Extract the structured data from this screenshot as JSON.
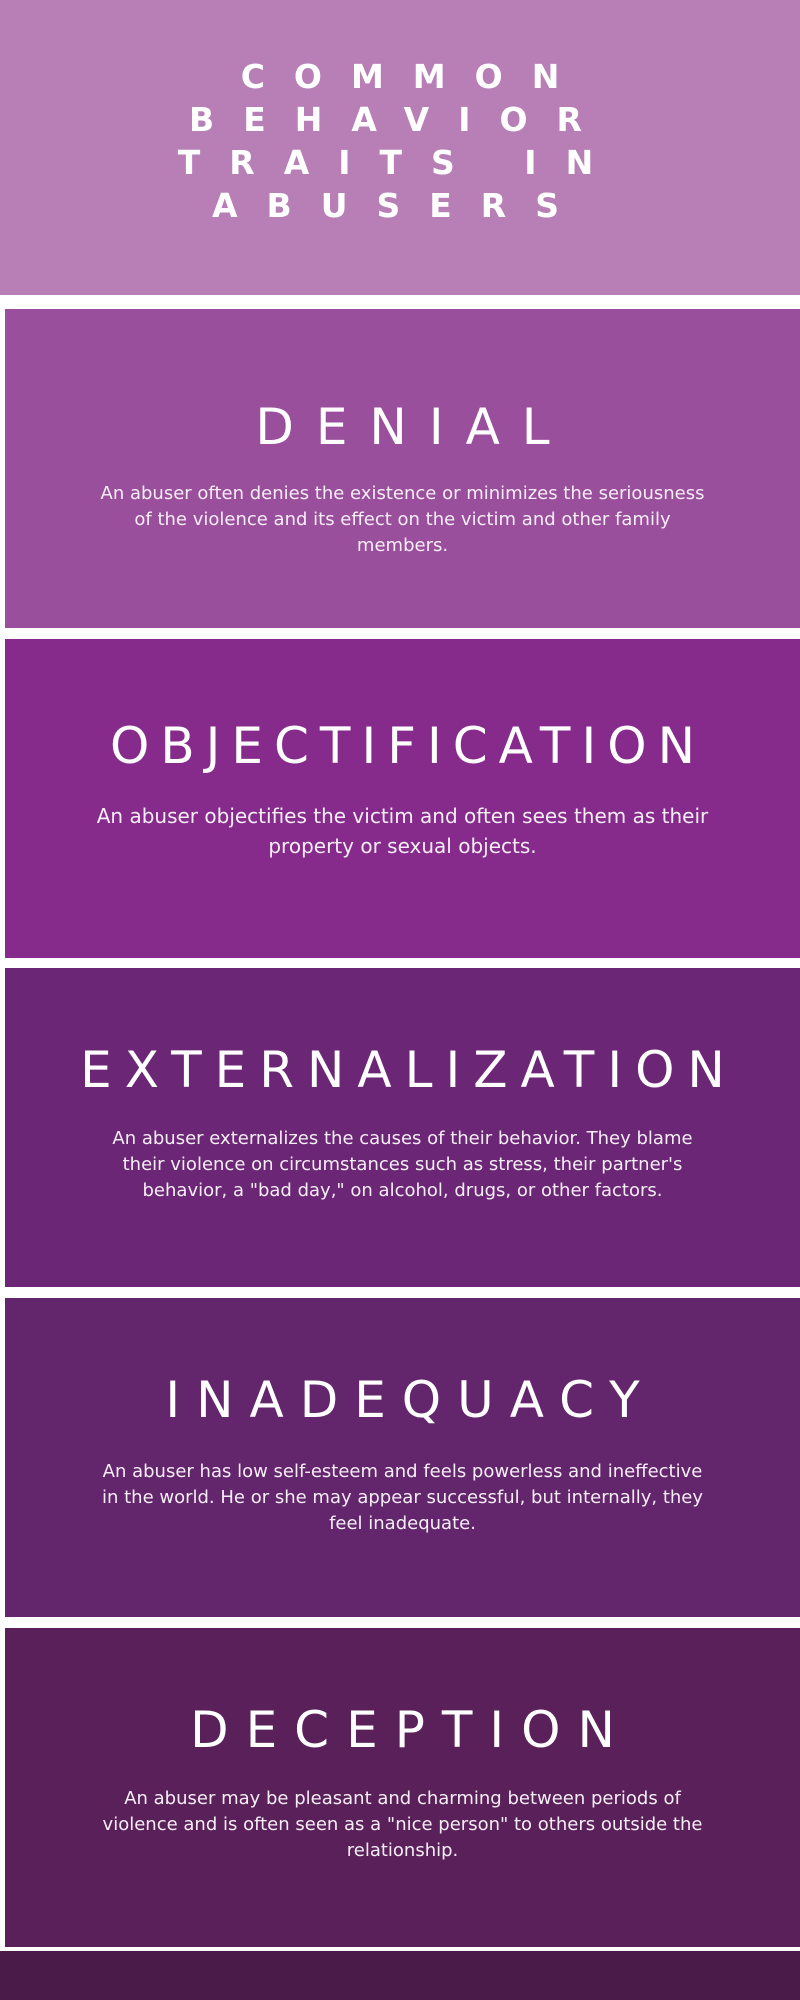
{
  "header": {
    "title": "COMMON\nBEHAVIOR\nTRAITS IN\nABUSERS",
    "color": "#b77fb6"
  },
  "sections": [
    {
      "title": "DENIAL",
      "body": "An abuser often denies the existence or minimizes the seriousness of the violence and its effect on the victim and other family members.",
      "color": "#9a4f9c"
    },
    {
      "title": "OBJECTIFICATION",
      "body": "An abuser objectifies the victim and often sees them as their property or sexual objects.",
      "color": "#862b8c"
    },
    {
      "title": "EXTERNALIZATION",
      "body": "An abuser externalizes the causes of their behavior. They blame their violence on circumstances such as stress, their partner's behavior, a \"bad day,\" on alcohol, drugs, or other factors.",
      "color": "#6b2775"
    },
    {
      "title": "INADEQUACY",
      "body": "An abuser has low self-esteem and feels powerless and ineffective in the world. He or she may appear successful, but internally, they feel inadequate.",
      "color": "#63256c"
    },
    {
      "title": "DECEPTION",
      "body": "An abuser may be pleasant and charming between periods of violence and is often seen as a \"nice person\" to others outside the relationship.",
      "color": "#5a2059"
    }
  ],
  "footer": {
    "color": "#4a1a48"
  }
}
